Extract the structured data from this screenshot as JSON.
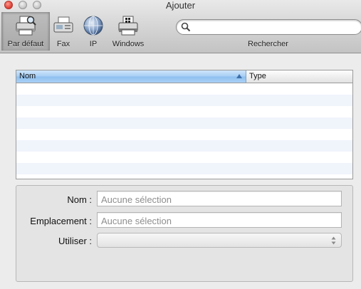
{
  "window": {
    "title": "Ajouter"
  },
  "toolbar": {
    "tools": [
      {
        "label": "Par défaut",
        "icon": "default-printer-icon",
        "selected": true
      },
      {
        "label": "Fax",
        "icon": "fax-icon",
        "selected": false
      },
      {
        "label": "IP",
        "icon": "globe-icon",
        "selected": false
      },
      {
        "label": "Windows",
        "icon": "windows-printer-icon",
        "selected": false
      }
    ],
    "search": {
      "label": "Rechercher",
      "value": "",
      "placeholder": ""
    }
  },
  "table": {
    "columns": [
      "Nom",
      "Type"
    ],
    "sorted_column": "Nom",
    "sort_direction": "ascending",
    "rows": []
  },
  "form": {
    "name_label": "Nom :",
    "name_placeholder": "Aucune sélection",
    "location_label": "Emplacement :",
    "location_placeholder": "Aucune sélection",
    "use_label": "Utiliser :",
    "use_value": ""
  },
  "colors": {
    "selected_header": "#a5cdf4",
    "alt_row": "#f0f4fb",
    "close_button": "#e2463b"
  }
}
